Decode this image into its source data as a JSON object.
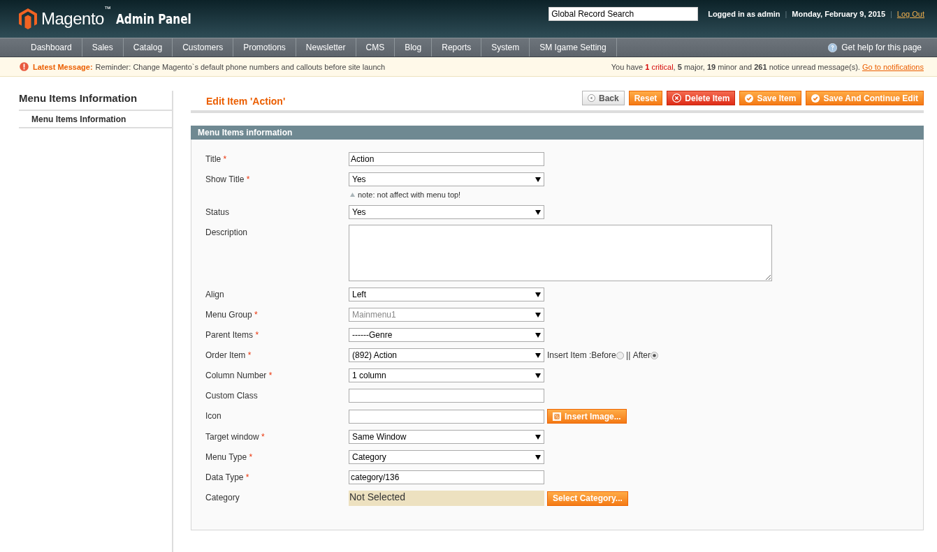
{
  "header": {
    "logo": {
      "brand": "Magento",
      "tm": "™",
      "product": "Admin Panel"
    },
    "search": {
      "value": "Global Record Search"
    },
    "user_bar": [
      {
        "kind": "text",
        "text": "Logged in as admin"
      },
      {
        "kind": "separator",
        "text": "|"
      },
      {
        "kind": "text",
        "text": "Monday, February 9, 2015"
      },
      {
        "kind": "separator",
        "text": "|"
      },
      {
        "kind": "link",
        "text": "Log Out"
      }
    ]
  },
  "nav": {
    "items": [
      {
        "label": "Dashboard",
        "selected": false
      },
      {
        "label": "Sales",
        "selected": false
      },
      {
        "label": "Catalog",
        "selected": false
      },
      {
        "label": "Customers",
        "selected": false
      },
      {
        "label": "Promotions",
        "selected": false
      },
      {
        "label": "Newsletter",
        "selected": false
      },
      {
        "label": "CMS",
        "selected": false
      },
      {
        "label": "Blog",
        "selected": false
      },
      {
        "label": "Reports",
        "selected": false
      },
      {
        "label": "System",
        "selected": false
      },
      {
        "label": "SM Igame Setting",
        "selected": false
      }
    ],
    "help": "Get help for this page"
  },
  "notice": {
    "heading": "Latest Message:",
    "text": "Reminder: Change Magento`s default phone numbers and callouts before site launch",
    "summary": {
      "prefix": "You have ",
      "counts": [
        {
          "count": "1",
          "label": " critical",
          "after": ", ",
          "kind": "critical"
        },
        {
          "count": "5",
          "label": " major",
          "after": ", ",
          "kind": "normal"
        },
        {
          "count": "19",
          "label": " minor",
          "after": " and ",
          "kind": "normal"
        },
        {
          "count": "261",
          "label": " notice",
          "after": " unread message(s). ",
          "kind": "normal"
        }
      ]
    },
    "link": "Go to notifications"
  },
  "sidebar": {
    "title": "Menu Items Information",
    "tabs": [
      {
        "label": "Menu Items Information",
        "selected": true
      }
    ]
  },
  "page": {
    "title": "Edit Item 'Action'",
    "buttons": [
      {
        "label": "Back",
        "kind": "back"
      },
      {
        "label": "Reset",
        "kind": "plain"
      },
      {
        "label": "Delete Item",
        "kind": "delete"
      },
      {
        "label": "Save Item",
        "kind": "save"
      },
      {
        "label": "Save And Continue Edit",
        "kind": "save"
      }
    ]
  },
  "form": {
    "section": "Menu Items information",
    "fields": [
      {
        "label": "Title",
        "required_mark": "*",
        "kind": "text",
        "value": "Action"
      },
      {
        "label": "Show Title",
        "required_mark": "*",
        "kind": "select",
        "value": "Yes",
        "disabled": false,
        "note": "note: not affect with menu top!"
      },
      {
        "label": "Status",
        "kind": "select",
        "value": "Yes",
        "disabled": false
      },
      {
        "label": "Description",
        "kind": "textarea"
      },
      {
        "label": "Align",
        "kind": "select",
        "value": "Left",
        "disabled": false
      },
      {
        "label": "Menu Group",
        "required_mark": "*",
        "kind": "select",
        "value": "Mainmenu1",
        "disabled": true
      },
      {
        "label": "Parent Items",
        "required_mark": "*",
        "kind": "select",
        "value": "------Genre",
        "disabled": false
      },
      {
        "label": "Order Item",
        "required_mark": "*",
        "kind": "select",
        "value": "(892) Action",
        "disabled": false,
        "insert": {
          "label": "Insert Item : ",
          "options": [
            {
              "label": "Before",
              "selected": false
            },
            {
              "label": "After",
              "selected": true
            }
          ],
          "separator": " || "
        }
      },
      {
        "label": "Column Number",
        "required_mark": "*",
        "kind": "select",
        "value": "1 column",
        "disabled": false
      },
      {
        "label": "Custom Class",
        "kind": "text"
      },
      {
        "label": "Icon",
        "kind": "text",
        "button": "Insert Image..."
      },
      {
        "label": "Target window",
        "required_mark": "*",
        "kind": "select",
        "value": "Same Window",
        "disabled": false
      },
      {
        "label": "Menu Type",
        "required_mark": "*",
        "kind": "select",
        "value": "Category",
        "disabled": false
      },
      {
        "label": "Data Type",
        "required_mark": "*",
        "kind": "text",
        "value": "category/136"
      },
      {
        "label": "Category",
        "kind": "chooser",
        "value": "Not Selected",
        "button": "Select Category..."
      }
    ]
  }
}
